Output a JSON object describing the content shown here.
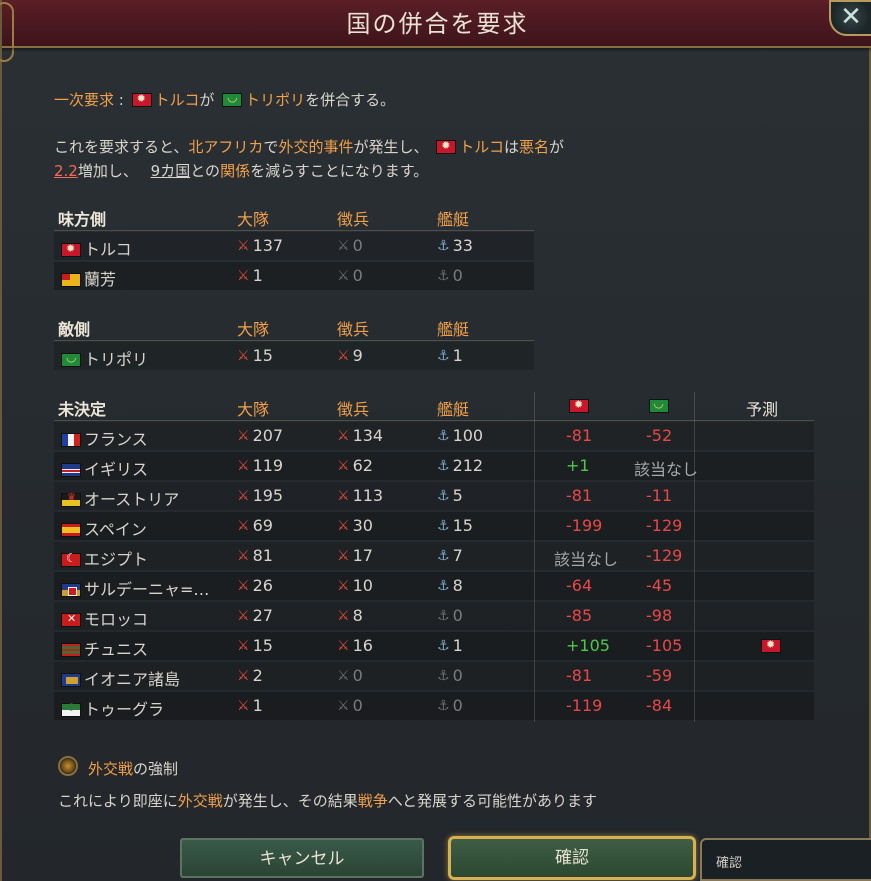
{
  "window": {
    "title": "国の併合を要求",
    "close_glyph": "✕"
  },
  "intro": {
    "label": "一次要求",
    "colon": ":",
    "country_a": "トルコ",
    "particle_ga": "が",
    "country_b": "トリポリ",
    "tail": "を併合する。"
  },
  "description": {
    "line1_pre": "これを要求すると、",
    "region": "北アフリカ",
    "line1_mid": "で",
    "event": "外交的事件",
    "line1_mid2": "が発生し、",
    "country": "トルコ",
    "particle_wa": "は",
    "infamy": "悪名",
    "line1_end": "が",
    "value": "2.2",
    "line2_mid": "増加し、",
    "countries_count": "9カ国",
    "line2_mid2": "との",
    "relations": "関係",
    "line2_end": "を減らすことになります。"
  },
  "columns": {
    "army": "大隊",
    "conscripts": "徴兵",
    "navy": "艦艇",
    "prediction": "予測"
  },
  "icons": {
    "army": "army-icon",
    "conscripts": "conscripts-icon",
    "navy": "navy-icon"
  },
  "allies": {
    "heading": "味方側",
    "rows": [
      {
        "flag": "turkey",
        "name": "トルコ",
        "army": "137",
        "conscripts": "0",
        "navy": "33"
      },
      {
        "flag": "lanfang",
        "name": "蘭芳",
        "army": "1",
        "conscripts": "0",
        "navy": "0"
      }
    ]
  },
  "enemies": {
    "heading": "敵側",
    "rows": [
      {
        "flag": "tripoli",
        "name": "トリポリ",
        "army": "15",
        "conscripts": "9",
        "navy": "1"
      }
    ]
  },
  "undecided": {
    "heading": "未決定",
    "rows": [
      {
        "flag": "france",
        "name": "フランス",
        "army": "207",
        "conscripts": "134",
        "navy": "100",
        "a": "-81",
        "b": "-52",
        "pred": ""
      },
      {
        "flag": "uk",
        "name": "イギリス",
        "army": "119",
        "conscripts": "62",
        "navy": "212",
        "a": "+1",
        "b": "該当なし",
        "pred": ""
      },
      {
        "flag": "austria",
        "name": "オーストリア",
        "army": "195",
        "conscripts": "113",
        "navy": "5",
        "a": "-81",
        "b": "-11",
        "pred": ""
      },
      {
        "flag": "spain",
        "name": "スペイン",
        "army": "69",
        "conscripts": "30",
        "navy": "15",
        "a": "-199",
        "b": "-129",
        "pred": ""
      },
      {
        "flag": "egypt",
        "name": "エジプト",
        "army": "81",
        "conscripts": "17",
        "navy": "7",
        "a": "該当なし",
        "b": "-129",
        "pred": ""
      },
      {
        "flag": "sardinia",
        "name": "サルデーニャ=…",
        "army": "26",
        "conscripts": "10",
        "navy": "8",
        "a": "-64",
        "b": "-45",
        "pred": ""
      },
      {
        "flag": "morocco",
        "name": "モロッコ",
        "army": "27",
        "conscripts": "8",
        "navy": "0",
        "a": "-85",
        "b": "-98",
        "pred": ""
      },
      {
        "flag": "tunis",
        "name": "チュニス",
        "army": "15",
        "conscripts": "16",
        "navy": "1",
        "a": "+105",
        "b": "-105",
        "pred": "turkey"
      },
      {
        "flag": "ionian",
        "name": "イオニア諸島",
        "army": "2",
        "conscripts": "0",
        "navy": "0",
        "a": "-81",
        "b": "-59",
        "pred": ""
      },
      {
        "flag": "touggourt",
        "name": "トゥーグラ",
        "army": "1",
        "conscripts": "0",
        "navy": "0",
        "a": "-119",
        "b": "-84",
        "pred": ""
      }
    ]
  },
  "option": {
    "label_hl": "外交戦",
    "label_rest": "の強制",
    "desc_pre": "これにより即座に",
    "desc_hl1": "外交戦",
    "desc_mid": "が発生し、その結果",
    "desc_hl2": "戦争",
    "desc_end": "へと発展する可能性があります"
  },
  "buttons": {
    "cancel": "キャンセル",
    "confirm": "確認"
  },
  "tooltip": {
    "text": "確認"
  },
  "colors": {
    "highlight": "#f0a04a",
    "positive": "#4ec84a",
    "negative": "#e84848",
    "title_bar": "#4a1820"
  }
}
